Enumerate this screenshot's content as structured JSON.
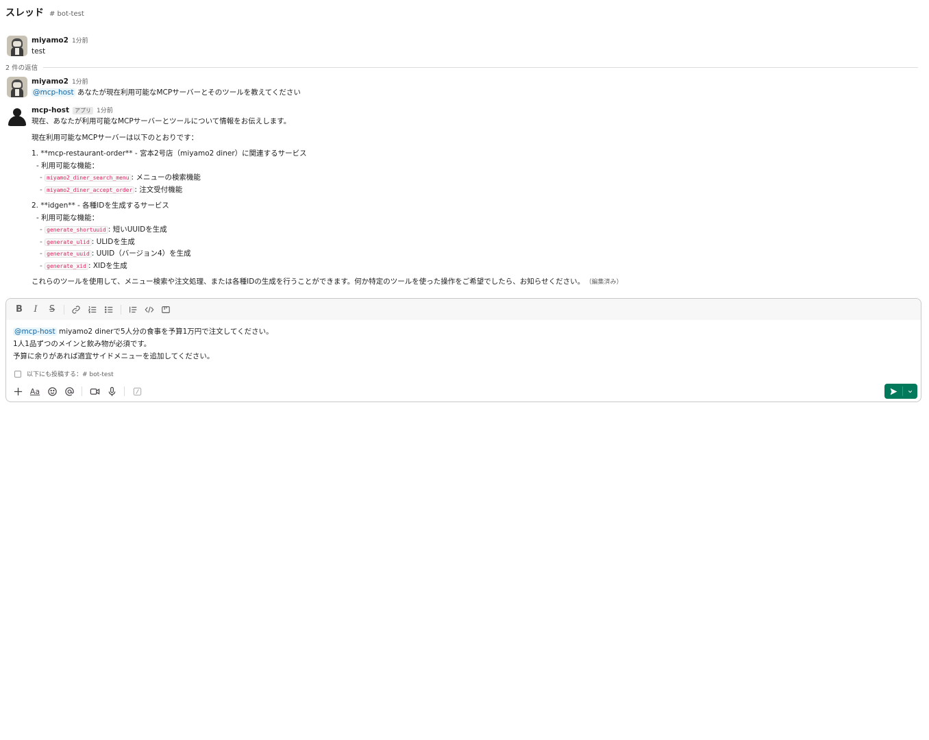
{
  "header": {
    "title": "スレッド",
    "channel": "# bot-test"
  },
  "parent": {
    "name": "miyamo2",
    "time": "1分前",
    "text": "test"
  },
  "replies_label": "2 件の返信",
  "reply1": {
    "name": "miyamo2",
    "time": "1分前",
    "mention": "@mcp-host",
    "text": " あなたが現在利用可能なMCPサーバーとそのツールを教えてください"
  },
  "reply2": {
    "name": "mcp-host",
    "badge": "アプリ",
    "time": "1分前",
    "intro": "現在、あなたが利用可能なMCPサーバーとツールについて情報をお伝えします。",
    "lead": "現在利用可能なMCPサーバーは以下のとおりです：",
    "servers": [
      {
        "title": "1. **mcp-restaurant-order** - 宮本2号店（miyamo2 diner）に関連するサービス",
        "subtitle": "- 利用可能な機能：",
        "tools": [
          {
            "code": "miyamo2_diner_search_menu",
            "desc": ": メニューの検索機能"
          },
          {
            "code": "miyamo2_diner_accept_order",
            "desc": ": 注文受付機能"
          }
        ]
      },
      {
        "title": "2. **idgen** - 各種IDを生成するサービス",
        "subtitle": "- 利用可能な機能：",
        "tools": [
          {
            "code": "generate_shortuuid",
            "desc": ": 短いUUIDを生成"
          },
          {
            "code": "generate_ulid",
            "desc": ": ULIDを生成"
          },
          {
            "code": "generate_uuid",
            "desc": ": UUID（バージョン4）を生成"
          },
          {
            "code": "generate_xid",
            "desc": ": XIDを生成"
          }
        ]
      }
    ],
    "closing": "これらのツールを使用して、メニュー検索や注文処理、または各種IDの生成を行うことができます。何か特定のツールを使った操作をご希望でしたら、お知らせください。",
    "edited": "（編集済み）"
  },
  "composer": {
    "mention": "@mcp-host",
    "line1": " miyamo2 dinerで5人分の食事を予算1万円で注文してください。",
    "line2": "1人1品ずつのメインと飲み物が必須です。",
    "line3": "予算に余りがあれば適宜サイドメニューを追加してください。",
    "also_post_label": "以下にも投稿する：# bot-test",
    "format_label": "Aa",
    "dash": "-"
  },
  "colors": {
    "send": "#007a5a",
    "mention": "#1264a3",
    "code": "#e01e5a"
  }
}
